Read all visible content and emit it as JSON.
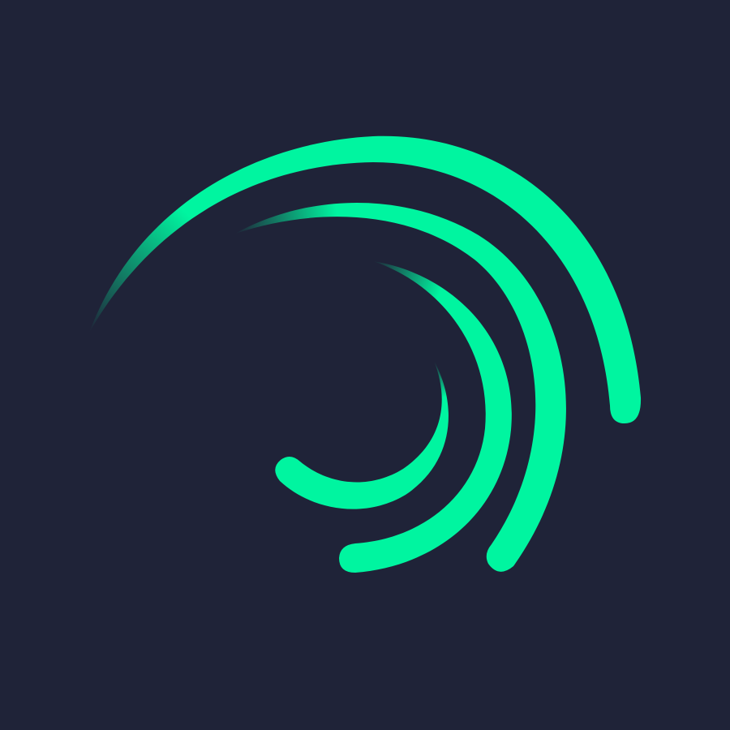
{
  "logo": {
    "icon": "swirl-arcs-logo-icon",
    "colors": {
      "background": "#1f2338",
      "accent": "#00f5a0",
      "accent_soft": "#00d98e"
    }
  }
}
